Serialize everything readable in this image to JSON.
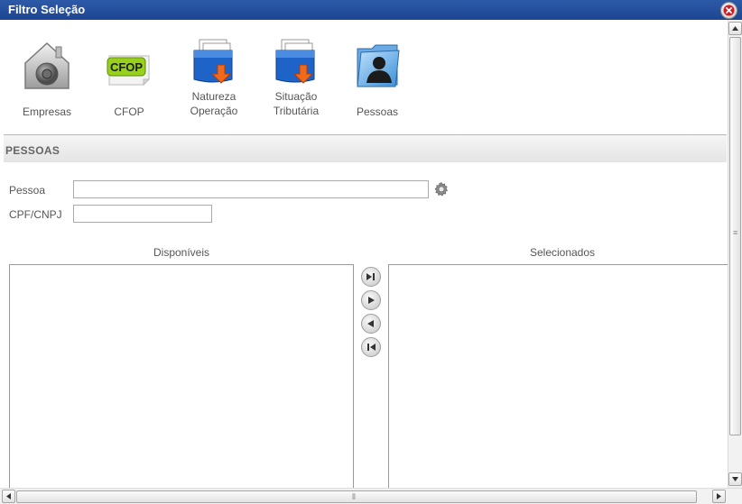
{
  "window": {
    "title": "Filtro Seleção"
  },
  "toolbar": {
    "items": [
      {
        "label": "Empresas",
        "icon": "vault-icon"
      },
      {
        "label": "CFOP",
        "icon": "cfop-icon"
      },
      {
        "label_line1": "Natureza",
        "label_line2": "Operação",
        "icon": "folder-download-icon"
      },
      {
        "label_line1": "Situação",
        "label_line2": "Tributária",
        "icon": "folder-download-icon"
      },
      {
        "label": "Pessoas",
        "icon": "person-folder-icon"
      }
    ],
    "cfop_badge": "CFOP"
  },
  "section": {
    "title": "PESSOAS"
  },
  "form": {
    "pessoa_label": "Pessoa",
    "pessoa_value": "",
    "cpf_label": "CPF/CNPJ",
    "cpf_value": ""
  },
  "lists": {
    "available_label": "Disponíveis",
    "selected_label": "Selecionados",
    "available_items": [],
    "selected_items": []
  },
  "colors": {
    "titlebar": "#1d4591",
    "accent_orange": "#f06a1e",
    "folder_blue": "#1e63c8"
  }
}
